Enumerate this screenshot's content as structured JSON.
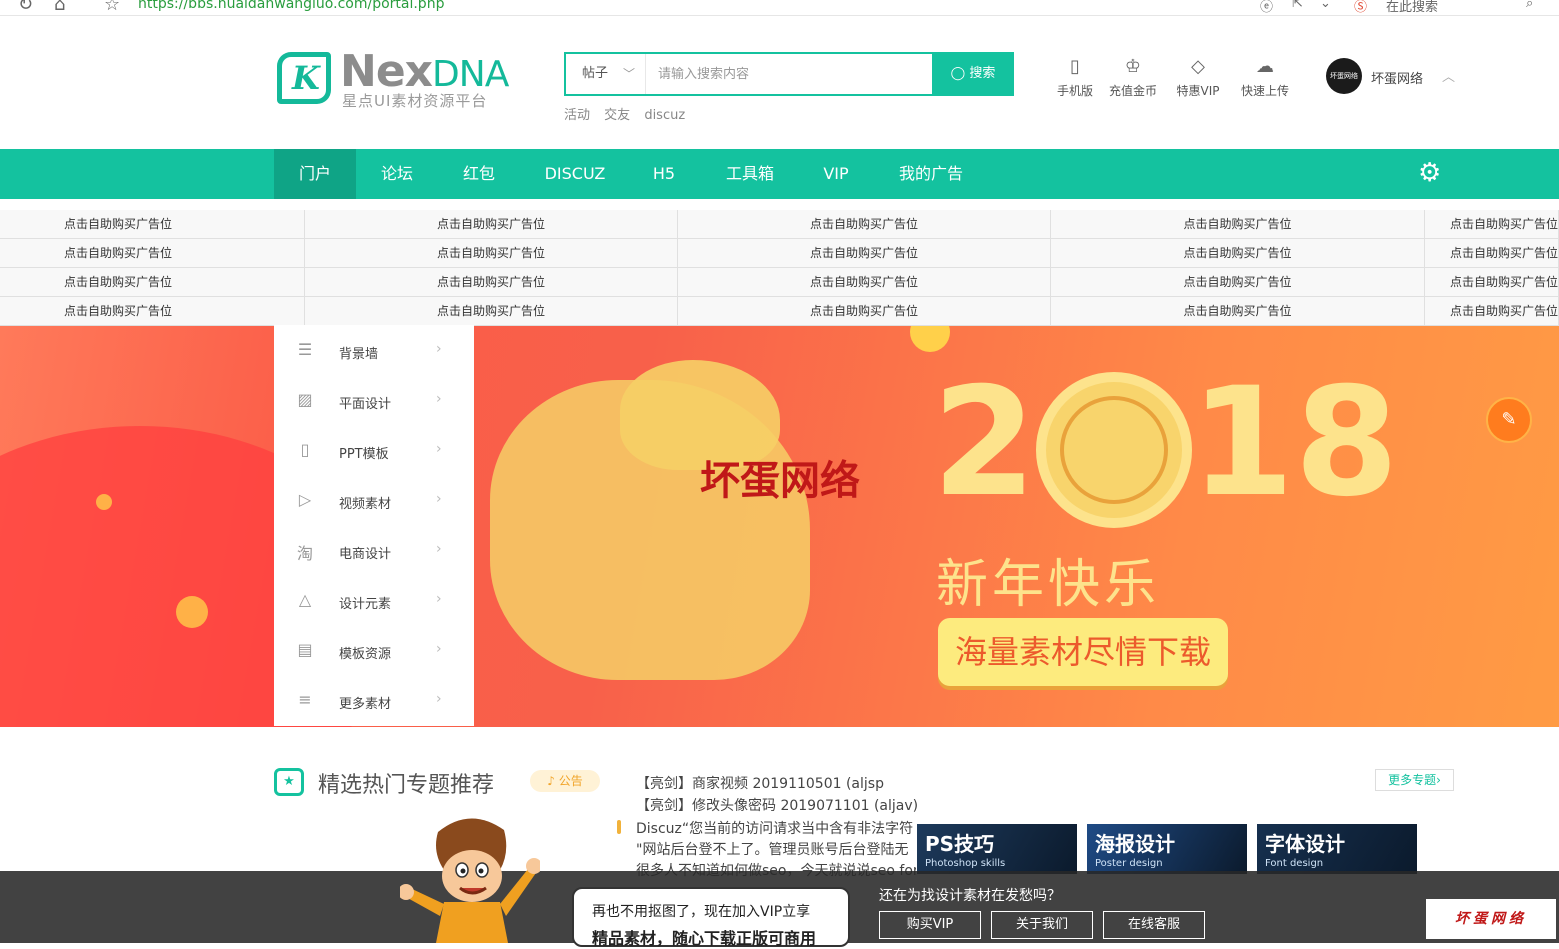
{
  "browser": {
    "url": "https://bbs.huaidanwangluo.com/portal.php",
    "search_hint": "在此搜索"
  },
  "header": {
    "logo_name": "Nex",
    "logo_name_accent": "DNA",
    "logo_subtitle": "星点UI素材资源平台",
    "search_type": "帖子",
    "search_placeholder": "请输入搜索内容",
    "search_button": "搜索",
    "hot_tags": [
      "活动",
      "交友",
      "discuz"
    ],
    "icons": [
      {
        "label": "手机版",
        "icon": "mobile-icon"
      },
      {
        "label": "充值金币",
        "icon": "crown-icon"
      },
      {
        "label": "特惠VIP",
        "icon": "diamond-icon"
      },
      {
        "label": "快速上传",
        "icon": "cloud-upload-icon"
      }
    ],
    "user_name": "坏蛋网络",
    "avatar_text": "坏蛋网络"
  },
  "nav": {
    "items": [
      "门户",
      "论坛",
      "红包",
      "DISCUZ",
      "H5",
      "工具箱",
      "VIP",
      "我的广告"
    ],
    "active": "门户"
  },
  "ads": {
    "cell_text": "点击自助购买广告位"
  },
  "category_menu": [
    {
      "label": "背景墙",
      "icon": "wall-icon"
    },
    {
      "label": "平面设计",
      "icon": "image-icon"
    },
    {
      "label": "PPT模板",
      "icon": "ppt-icon"
    },
    {
      "label": "视频素材",
      "icon": "video-icon"
    },
    {
      "label": "电商设计",
      "icon": "taobao-icon"
    },
    {
      "label": "设计元素",
      "icon": "shapes-icon"
    },
    {
      "label": "模板资源",
      "icon": "template-icon"
    },
    {
      "label": "更多素材",
      "icon": "list-icon"
    }
  ],
  "banner": {
    "year_left": "2",
    "year_right": "18",
    "greeting": "新年快乐",
    "cta": "海量素材尽情下载",
    "watermark": "坏蛋网络"
  },
  "section": {
    "title": "精选热门专题推荐",
    "notice_label": "公告",
    "more_label": "更多专题›",
    "news": [
      "【亮剑】商家视频 2019110501 (aljsp",
      "【亮剑】修改头像密码 2019071101 (aljav)",
      "Discuz“您当前的访问请求当中含有非法字符",
      "\"网站后台登不上了。管理员账号后台登陆无",
      "很多人不知道如何做seo，今天就说说seo for"
    ],
    "thumbs": [
      {
        "title": "PS技巧",
        "sub": "Photoshop skills",
        "color": "#1d3a5c"
      },
      {
        "title": "海报设计",
        "sub": "Poster design",
        "color": "#1f4b86"
      },
      {
        "title": "字体设计",
        "sub": "Font design",
        "color": "#16304f"
      }
    ]
  },
  "promo": {
    "bubble_line1": "再也不用抠图了，现在加入VIP立享",
    "bubble_line2": "精品素材，随心下载正版可商用",
    "question": "还在为找设计素材在发愁吗？",
    "buttons": [
      "购买VIP",
      "关于我们",
      "在线客服"
    ],
    "brand": "坏蛋网络"
  }
}
